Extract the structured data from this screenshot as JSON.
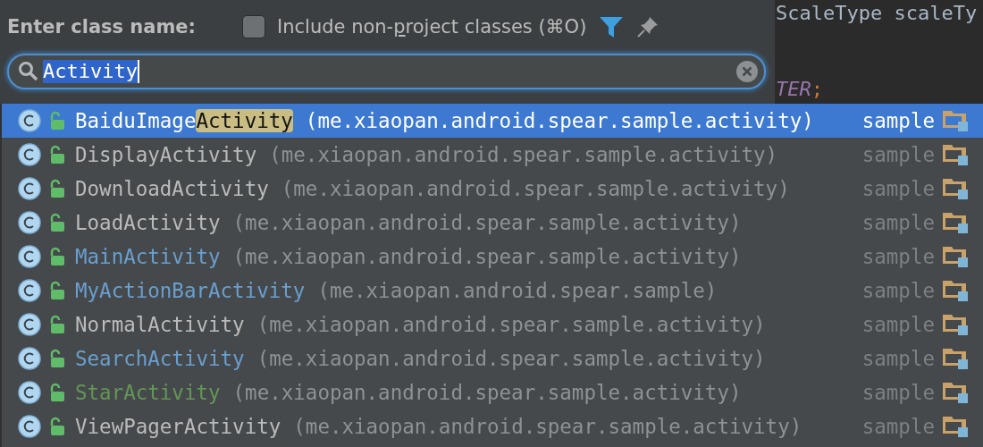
{
  "editor": {
    "lines": [
      {
        "kind": "plain",
        "text": "ScaleType scaleTy"
      },
      {
        "kind": "constant",
        "text": "TER",
        "punct": ";"
      }
    ]
  },
  "popup": {
    "title": "Enter class name:",
    "include_option": {
      "checked": false,
      "label_parts": [
        {
          "text": "Include non-",
          "underlined": false
        },
        {
          "text": "p",
          "underlined": true
        },
        {
          "text": "roject classes (⌘O)",
          "underlined": false
        }
      ]
    },
    "search": {
      "value": "Activity",
      "text_selected": true
    },
    "results": [
      {
        "selected": true,
        "color": "#ffffff",
        "name_parts": [
          {
            "text": "BaiduImage",
            "matched": false
          },
          {
            "text": "Activity",
            "matched": true
          }
        ],
        "package": "(me.xiaopan.android.spear.sample.activity)",
        "module": "sample"
      },
      {
        "selected": false,
        "color": "#bbbbbb",
        "name_parts": [
          {
            "text": "DisplayActivity",
            "matched": false
          }
        ],
        "package": "(me.xiaopan.android.spear.sample.activity)",
        "module": "sample"
      },
      {
        "selected": false,
        "color": "#bbbbbb",
        "name_parts": [
          {
            "text": "DownloadActivity",
            "matched": false
          }
        ],
        "package": "(me.xiaopan.android.spear.sample.activity)",
        "module": "sample"
      },
      {
        "selected": false,
        "color": "#bbbbbb",
        "name_parts": [
          {
            "text": "LoadActivity",
            "matched": false
          }
        ],
        "package": "(me.xiaopan.android.spear.sample.activity)",
        "module": "sample"
      },
      {
        "selected": false,
        "color": "#6a9fcf",
        "name_parts": [
          {
            "text": "MainActivity",
            "matched": false
          }
        ],
        "package": "(me.xiaopan.android.spear.sample.activity)",
        "module": "sample"
      },
      {
        "selected": false,
        "color": "#6a9fcf",
        "name_parts": [
          {
            "text": "MyActionBarActivity",
            "matched": false
          }
        ],
        "package": "(me.xiaopan.android.spear.sample)",
        "module": "sample"
      },
      {
        "selected": false,
        "color": "#bbbbbb",
        "name_parts": [
          {
            "text": "NormalActivity",
            "matched": false
          }
        ],
        "package": "(me.xiaopan.android.spear.sample.activity)",
        "module": "sample"
      },
      {
        "selected": false,
        "color": "#6a9fcf",
        "name_parts": [
          {
            "text": "SearchActivity",
            "matched": false
          }
        ],
        "package": "(me.xiaopan.android.spear.sample.activity)",
        "module": "sample"
      },
      {
        "selected": false,
        "color": "#629755",
        "name_parts": [
          {
            "text": "StarActivity",
            "matched": false
          }
        ],
        "package": "(me.xiaopan.android.spear.sample.activity)",
        "module": "sample"
      },
      {
        "selected": false,
        "color": "#bbbbbb",
        "name_parts": [
          {
            "text": "ViewPagerActivity",
            "matched": false
          }
        ],
        "package": "(me.xiaopan.android.spear.sample.activity)",
        "module": "sample"
      }
    ]
  }
}
